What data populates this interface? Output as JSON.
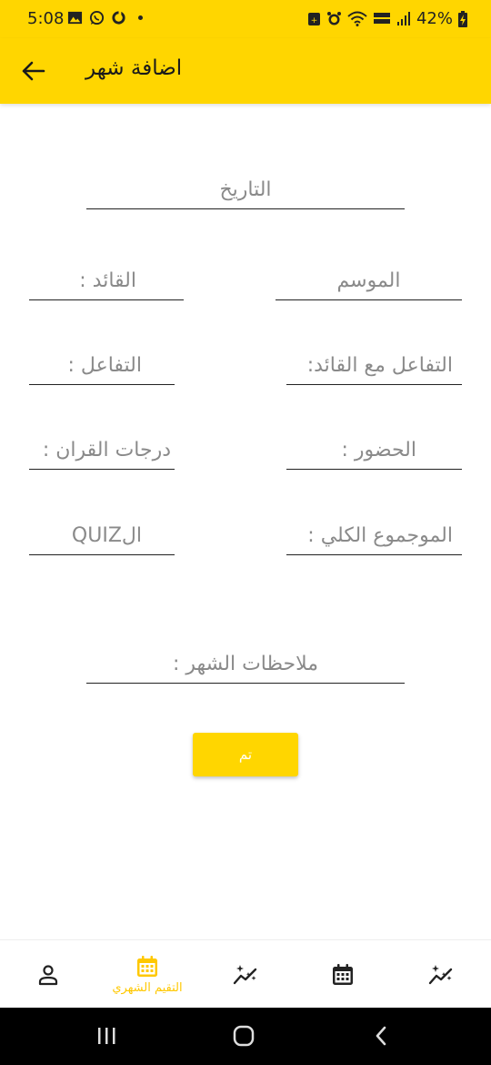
{
  "status_bar": {
    "time": "5:08",
    "battery": "42%"
  },
  "app_bar": {
    "title": "اضافة شهر",
    "back_icon": "arrow-left-icon"
  },
  "form": {
    "date_placeholder": "التاريخ",
    "season_placeholder": "الموسم",
    "leader_placeholder": "القائد :",
    "leader_interaction_placeholder": "التفاعل مع القائد:",
    "interaction_placeholder": "التفاعل :",
    "attendance_placeholder": "الحضور :",
    "quran_grades_placeholder": "درجات القران :",
    "total_placeholder": "الموجموع الكلي :",
    "quiz_placeholder": "الQUIZ",
    "notes_placeholder": "ملاحظات الشهر :",
    "submit_label": "تم"
  },
  "bottom_nav": {
    "items": [
      {
        "icon": "person-icon",
        "label": ""
      },
      {
        "icon": "calendar-icon",
        "label": "التقيم الشهري",
        "active": true
      },
      {
        "icon": "sparkle-trend-icon",
        "label": ""
      },
      {
        "icon": "calendar-icon",
        "label": ""
      },
      {
        "icon": "sparkle-trend-icon",
        "label": ""
      }
    ]
  },
  "colors": {
    "primary": "#FFD600",
    "active_nav": "#FFC800",
    "placeholder": "#8a8a8a"
  }
}
